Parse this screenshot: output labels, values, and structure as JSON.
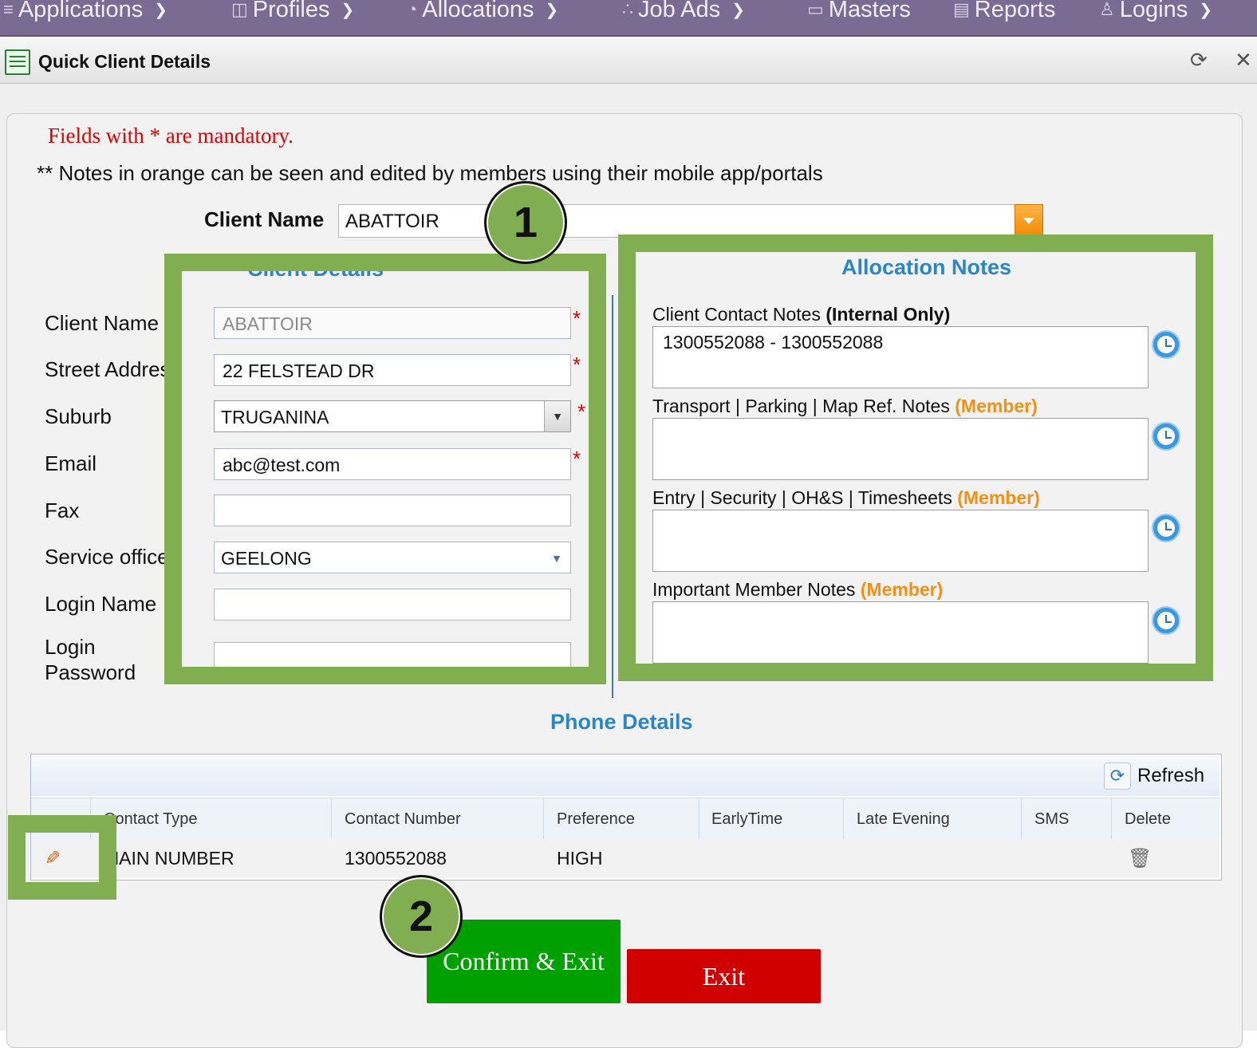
{
  "nav": {
    "items": [
      {
        "label": "Applications",
        "icon": "list-icon"
      },
      {
        "label": "Profiles",
        "icon": "profile-icon"
      },
      {
        "label": "Allocations",
        "icon": "pie-icon"
      },
      {
        "label": "Job Ads",
        "icon": "nodes-icon"
      },
      {
        "label": "Masters",
        "icon": "folder-icon"
      },
      {
        "label": "Reports",
        "icon": "document-icon"
      },
      {
        "label": "Logins",
        "icon": "user-icon"
      }
    ]
  },
  "window": {
    "title": "Quick Client Details"
  },
  "form": {
    "mandatory_note": "Fields with * are mandatory.",
    "orange_note": "** Notes in orange can be seen and edited by members using their mobile app/portals",
    "client_name_label": "Client Name",
    "client_name_value": "ABATTOIR"
  },
  "client_details": {
    "title": "Client Details",
    "fields": [
      {
        "label": "Client Name",
        "value": "ABATTOIR",
        "required": true
      },
      {
        "label": "Street Address",
        "value": "22 FELSTEAD DR",
        "required": true
      },
      {
        "label": "Suburb",
        "value": "TRUGANINA",
        "required": true
      },
      {
        "label": "Email",
        "value": "abc@test.com",
        "required": true
      },
      {
        "label": "Fax",
        "value": "",
        "required": false
      },
      {
        "label": "Service office",
        "value": "GEELONG",
        "required": false
      },
      {
        "label": "Login Name",
        "value": "",
        "required": false
      },
      {
        "label": "Login Password",
        "value": "",
        "required": false
      }
    ]
  },
  "allocation_notes": {
    "title": "Allocation Notes",
    "notes": [
      {
        "label": "Client Contact Notes ",
        "tag": "(Internal Only)",
        "value": "1300552088 - 1300552088"
      },
      {
        "label": "Transport | Parking | Map Ref. Notes ",
        "tag": "(Member)",
        "value": ""
      },
      {
        "label": "Entry | Security | OH&S | Timesheets ",
        "tag": "(Member)",
        "value": ""
      },
      {
        "label": "Important Member Notes ",
        "tag": "(Member)",
        "value": ""
      }
    ]
  },
  "phone_details": {
    "title": "Phone Details",
    "refresh_label": "Refresh",
    "columns": [
      "Contact Type",
      "Contact Number",
      "Preference",
      "EarlyTime",
      "Late Evening",
      "SMS",
      "Delete"
    ],
    "rows": [
      {
        "contact_type": "MAIN NUMBER",
        "contact_number": "1300552088",
        "preference": "HIGH",
        "early_time": "",
        "late_evening": "",
        "sms": ""
      }
    ]
  },
  "buttons": {
    "confirm_exit": "Confirm & Exit",
    "exit": "Exit"
  },
  "callouts": [
    "1",
    "2"
  ],
  "colors": {
    "nav_bg": "#7a6b93",
    "highlight_green": "#82ae52",
    "section_blue": "#2a86c9",
    "member_orange": "#f39016",
    "confirm_green": "#00a000",
    "exit_red": "#d00000",
    "mandatory_red": "#e00000"
  }
}
